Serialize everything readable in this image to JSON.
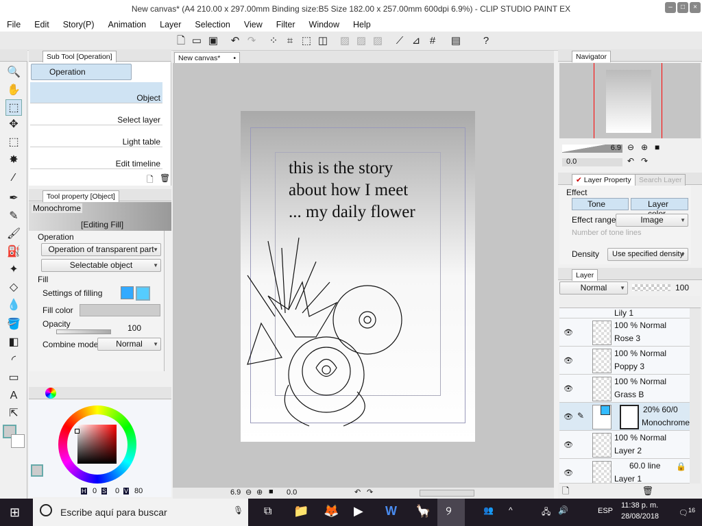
{
  "window": {
    "title": "New canvas* (A4 210.00 x 297.00mm Binding size:B5 Size 182.00 x 257.00mm 600dpi 6.9%) - CLIP STUDIO PAINT EX"
  },
  "menu": [
    "File",
    "Edit",
    "Story(P)",
    "Animation",
    "Layer",
    "Selection",
    "View",
    "Filter",
    "Window",
    "Help"
  ],
  "subtool": {
    "tab": "Sub Tool [Operation]",
    "group": "Operation",
    "items": [
      "Object",
      "Select layer",
      "Light table",
      "Edit timeline"
    ]
  },
  "toolproperty": {
    "tab": "Tool property [Object]",
    "preset": "Monochrome",
    "mode": "[Editing Fill]",
    "operation_label": "Operation",
    "operation_value": "Operation of transparent part",
    "selectable": "Selectable object",
    "fill_label": "Fill",
    "settings_label": "Settings of filling",
    "fillcolor_label": "Fill color",
    "opacity_label": "Opacity",
    "opacity_value": "100",
    "combine_label": "Combine mode",
    "combine_value": "Normal"
  },
  "color": {
    "h_label": "H",
    "h": "0",
    "s_label": "S",
    "s": "0",
    "v_label": "V",
    "v": "80",
    "main_color": "#cccccc"
  },
  "canvas": {
    "tab": "New canvas*",
    "text": [
      "this is the story",
      "about how I meet",
      "... my daily flower"
    ],
    "zoom": "6.9",
    "rotation": "0.0"
  },
  "navigator": {
    "tab": "Navigator",
    "zoom": "6.9",
    "rotation": "0.0"
  },
  "layerproperty": {
    "tab": "Layer Property",
    "tab2": "Search Layer",
    "effect_label": "Effect",
    "tone": "Tone",
    "layer_color": "Layer color",
    "range_label": "Effect range",
    "range_value": "Image",
    "tonelines_label": "Number of tone lines",
    "density_label": "Density",
    "density_value": "Use specified density"
  },
  "layers": {
    "tab": "Layer",
    "blend": "Normal",
    "opacity": "100",
    "partial_top": "Lily 1",
    "rows": [
      {
        "info": "100 %  Normal",
        "name": "Rose 3"
      },
      {
        "info": "100 %  Normal",
        "name": "Poppy 3"
      },
      {
        "info": "100 %  Normal",
        "name": "Grass B"
      },
      {
        "info": "20% 60/0",
        "name": "Monochrome"
      },
      {
        "info": "100 %  Normal",
        "name": "Layer 2"
      },
      {
        "info": "60.0 line",
        "name": "Layer 1"
      }
    ]
  },
  "taskbar": {
    "search": "Escribe aquí para buscar",
    "lang": "ESP",
    "time": "11:38 p. m.",
    "date": "28/08/2018",
    "notifications": "16"
  }
}
